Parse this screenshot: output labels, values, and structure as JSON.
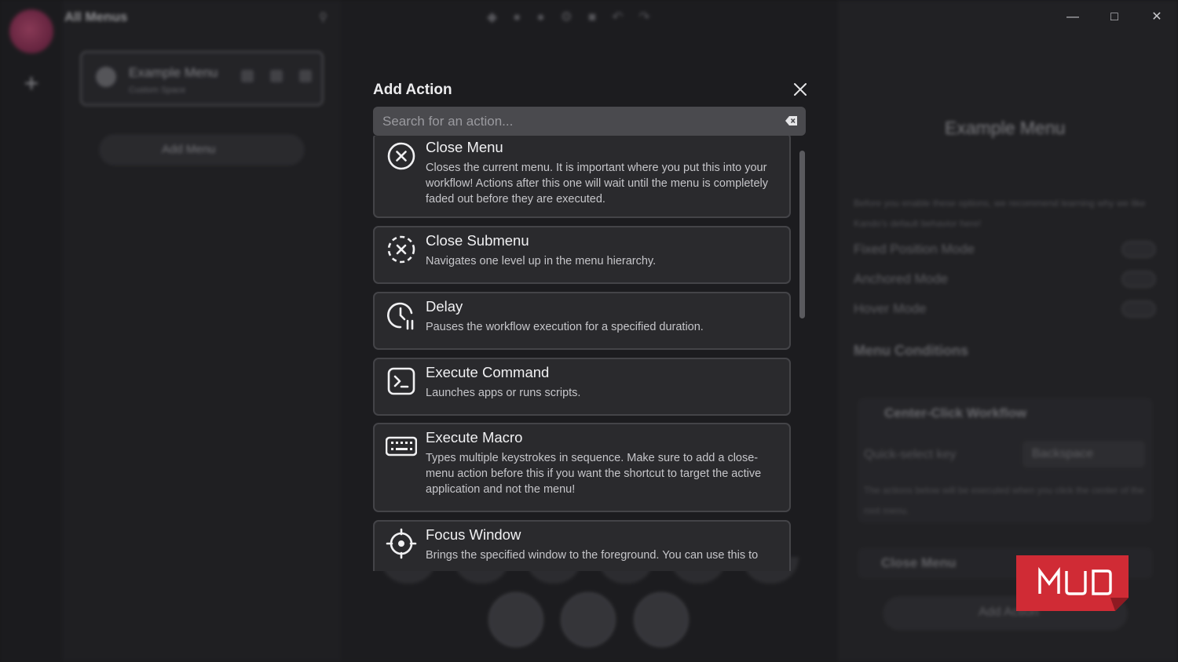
{
  "window": {
    "minimize_icon": "minimize-icon",
    "maximize_icon": "maximize-icon",
    "close_icon": "close-icon"
  },
  "background": {
    "menus_title": "All Menus",
    "menu_card": {
      "name": "Example Menu",
      "shortcut": "Custom Space"
    },
    "add_menu_label": "Add Menu",
    "properties": {
      "title": "Example Menu",
      "description": "Before you enable these options, we recommend learning why we like Kando's default behavior here!",
      "rows": [
        "Fixed Position Mode",
        "Anchored Mode",
        "Hover Mode"
      ],
      "section": "Menu Conditions",
      "workflow_title": "Center-Click Workflow",
      "quick_select_label": "Quick-select key",
      "quick_select_value": "Backspace",
      "workflow_desc": "The actions below will be executed when you click the center of the root menu.",
      "close_menu_label": "Close Menu",
      "add_action_label": "Add Action"
    }
  },
  "modal": {
    "title": "Add Action",
    "search_placeholder": "Search for an action...",
    "search_value": "",
    "items": [
      {
        "name": "Close Menu",
        "icon": "close-circle-icon",
        "description": "Closes the current menu. It is important where you put this into your workflow! Actions after this one will wait until the menu is completely faded out before they are executed."
      },
      {
        "name": "Close Submenu",
        "icon": "close-dashed-circle-icon",
        "description": "Navigates one level up in the menu hierarchy."
      },
      {
        "name": "Delay",
        "icon": "clock-pause-icon",
        "description": "Pauses the workflow execution for a specified duration."
      },
      {
        "name": "Execute Command",
        "icon": "terminal-icon",
        "description": "Launches apps or runs scripts."
      },
      {
        "name": "Execute Macro",
        "icon": "keyboard-icon",
        "description": "Types multiple keystrokes in sequence. Make sure to add a close-menu action before this if you want the shortcut to target the active application and not the menu!"
      },
      {
        "name": "Focus Window",
        "icon": "crosshair-icon",
        "description": "Brings the specified window to the foreground. You can use this to"
      }
    ]
  },
  "watermark": {
    "text": "MUO",
    "color": "#d02b35"
  }
}
